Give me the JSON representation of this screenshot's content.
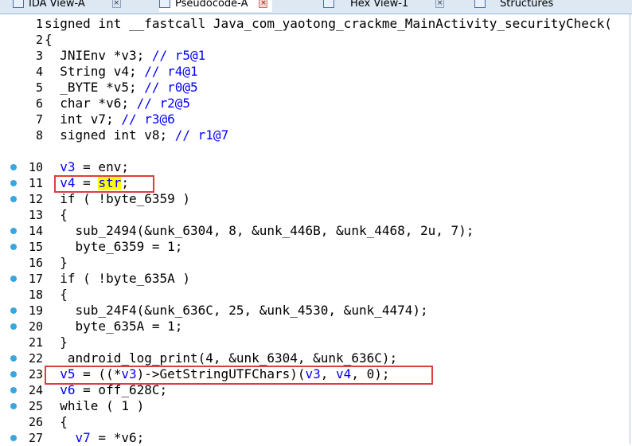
{
  "tabs": [
    {
      "label": "IDA View-A"
    },
    {
      "label": "Pseudocode-A"
    },
    {
      "label": "Hex View-1"
    },
    {
      "label": "Structures"
    }
  ],
  "lines": {
    "l1": {
      "num": "1",
      "t": "signed int __fastcall Java_com_yaotong_crackme_MainActivity_securityCheck("
    },
    "l2": {
      "num": "2",
      "t": "{"
    },
    "l3": {
      "num": "3",
      "a": "  JNIEnv *v3; ",
      "b": "// r5@1"
    },
    "l4": {
      "num": "4",
      "a": "  String v4; ",
      "b": "// r4@1"
    },
    "l5": {
      "num": "5",
      "a": "  _BYTE *v5; ",
      "b": "// r0@5"
    },
    "l6": {
      "num": "6",
      "a": "  char *v6; ",
      "b": "// r2@5"
    },
    "l7": {
      "num": "7",
      "a": "  int v7; ",
      "b": "// r3@6"
    },
    "l8": {
      "num": "8",
      "a": "  signed int v8; ",
      "b": "// r1@7"
    },
    "l10": {
      "num": "10",
      "v": "v3",
      "t": " = env;"
    },
    "l11": {
      "num": "11",
      "v": "v4",
      "eq": " = ",
      "s": "str",
      "t": ";"
    },
    "l12": {
      "num": "12",
      "t": "  if ( !byte_6359 )"
    },
    "l13": {
      "num": "13",
      "t": "  {"
    },
    "l14": {
      "num": "14",
      "t": "    sub_2494(&unk_6304, 8, &unk_446B, &unk_4468, 2u, 7);"
    },
    "l15": {
      "num": "15",
      "t": "    byte_6359 = 1;"
    },
    "l16": {
      "num": "16",
      "t": "  }"
    },
    "l17": {
      "num": "17",
      "t": "  if ( !byte_635A )"
    },
    "l18": {
      "num": "18",
      "t": "  {"
    },
    "l19": {
      "num": "19",
      "t": "    sub_24F4(&unk_636C, 25, &unk_4530, &unk_4474);"
    },
    "l20": {
      "num": "20",
      "t": "    byte_635A = 1;"
    },
    "l21": {
      "num": "21",
      "t": "  }"
    },
    "l22": {
      "num": "22",
      "t": "   android_log_print(4, &unk_6304, &unk_636C);"
    },
    "l23": {
      "num": "23",
      "v5": "v5",
      "p1": " = ((*",
      "v3": "v3",
      "p2": ")->GetStringUTFChars)(",
      "v3b": "v3",
      "p3": ", ",
      "v4": "v4",
      "p4": ", 0);"
    },
    "l24": {
      "num": "24",
      "v": "v6",
      "t": " = off_628C;"
    },
    "l25": {
      "num": "25",
      "t": "  while ( 1 )"
    },
    "l26": {
      "num": "26",
      "t": "  {"
    },
    "l27": {
      "num": "27",
      "v": "v7",
      "t": " = *v6;"
    }
  }
}
